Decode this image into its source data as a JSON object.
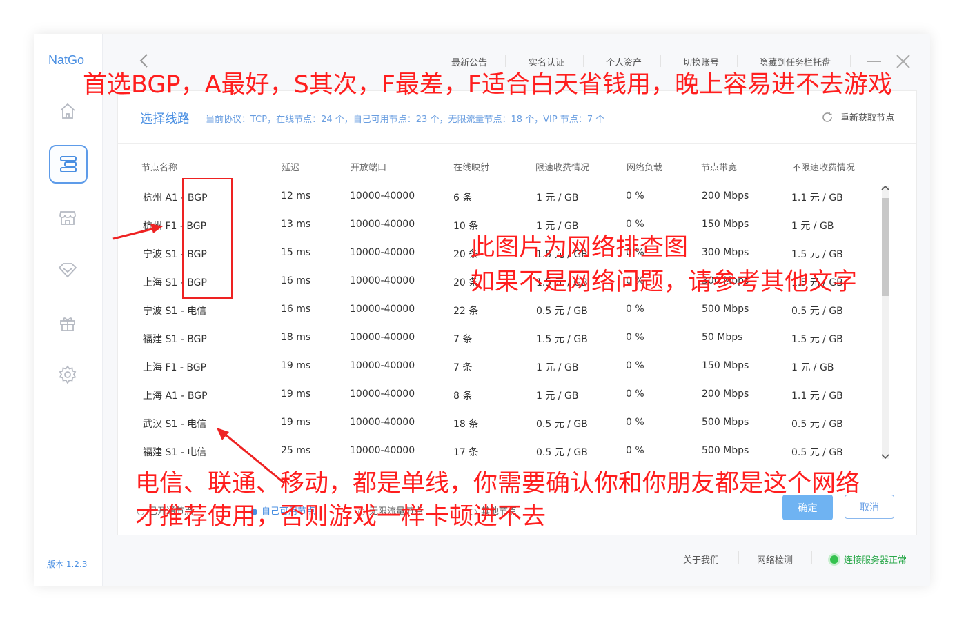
{
  "app": {
    "name": "NatGo",
    "version": "版本 1.2.3"
  },
  "sidebar": {
    "items": [
      {
        "name": "home",
        "icon": "home-icon"
      },
      {
        "name": "routes",
        "icon": "route-list-icon",
        "active": true
      },
      {
        "name": "store",
        "icon": "store-icon"
      },
      {
        "name": "vip",
        "icon": "diamond-icon"
      },
      {
        "name": "gift",
        "icon": "gift-icon"
      },
      {
        "name": "settings",
        "icon": "gear-icon"
      }
    ]
  },
  "topbar": {
    "links": [
      "最新公告",
      "实名认证",
      "个人资产",
      "切换账号",
      "隐藏到任务栏托盘"
    ]
  },
  "panel": {
    "title": "选择线路",
    "stats": "当前协议：TCP，在线节点：24 个，自己可用节点：23 个，无限流量节点：18 个，VIP 节点：7 个",
    "refresh_label": "重新获取节点"
  },
  "table": {
    "columns": [
      "节点名称",
      "延迟",
      "开放端口",
      "在线映射",
      "限速收费情况",
      "网络负载",
      "节点带宽",
      "不限速收费情况"
    ],
    "rows": [
      [
        "杭州 A1 - BGP",
        "12 ms",
        "10000-40000",
        "6 条",
        "1 元 / GB",
        "0 %",
        "200 Mbps",
        "1.1 元 / GB"
      ],
      [
        "杭州 F1 - BGP",
        "13 ms",
        "10000-40000",
        "10 条",
        "1 元 / GB",
        "0 %",
        "150 Mbps",
        "1 元 / GB"
      ],
      [
        "宁波 S1 - BGP",
        "15 ms",
        "10000-40000",
        "20 条",
        "1.5 元 / GB",
        "0 %",
        "300 Mbps",
        "1.5 元 / GB"
      ],
      [
        "上海 S1 - BGP",
        "16 ms",
        "10000-40000",
        "20 条",
        "1.5 元 / GB",
        "0 %",
        "300 Mbps",
        "1.5 元 / GB"
      ],
      [
        "宁波 S1 - 电信",
        "16 ms",
        "10000-40000",
        "22 条",
        "0.5 元 / GB",
        "0 %",
        "500 Mbps",
        "0.5 元 / GB"
      ],
      [
        "福建 S1 - BGP",
        "18 ms",
        "10000-40000",
        "7 条",
        "1.5 元 / GB",
        "0 %",
        "50 Mbps",
        "1.5 元 / GB"
      ],
      [
        "上海 F1 - BGP",
        "19 ms",
        "10000-40000",
        "7 条",
        "1 元 / GB",
        "0 %",
        "150 Mbps",
        "1 元 / GB"
      ],
      [
        "上海 A1 - BGP",
        "19 ms",
        "10000-40000",
        "8 条",
        "1 元 / GB",
        "0 %",
        "200 Mbps",
        "1.1 元 / GB"
      ],
      [
        "武汉 S1 - 电信",
        "19 ms",
        "10000-40000",
        "18 条",
        "0.5 元 / GB",
        "0 %",
        "500 Mbps",
        "0.5 元 / GB"
      ],
      [
        "福建 S1 - 电信",
        "25 ms",
        "10000-40000",
        "17 条",
        "0.5 元 / GB",
        "0 %",
        "500 Mbps",
        "0.5 元 / GB"
      ]
    ]
  },
  "footer": {
    "filters": [
      {
        "label": "已开通节点",
        "active": false
      },
      {
        "label": "自己可用节点",
        "active": true
      },
      {
        "label": "无限流量节点",
        "active": false
      },
      {
        "label": "其他节点",
        "active": false
      }
    ],
    "ok_label": "确定",
    "cancel_label": "取消"
  },
  "statusbar": {
    "about": "关于我们",
    "network_check": "网络检测",
    "status": "连接服务器正常"
  },
  "annotations": {
    "top_note": "首选BGP，A最好，S其次，F最差，F适合白天省钱用，晚上容易进不去游戏",
    "mid_note_1": "此图片为网络排查图",
    "mid_note_2": "如果不是网络问题，请参考其他文字",
    "bottom_note_1": "电信、联通、移动，都是单线，你需要确认你和你朋友都是这个网络",
    "bottom_note_2": "才推荐使用，否则游戏一样卡顿进不去"
  },
  "colors": {
    "accent": "#4a8fe2",
    "annotation": "#ff1e1e",
    "ok_button": "#6fb3f2",
    "status_ok": "#35c24f"
  }
}
